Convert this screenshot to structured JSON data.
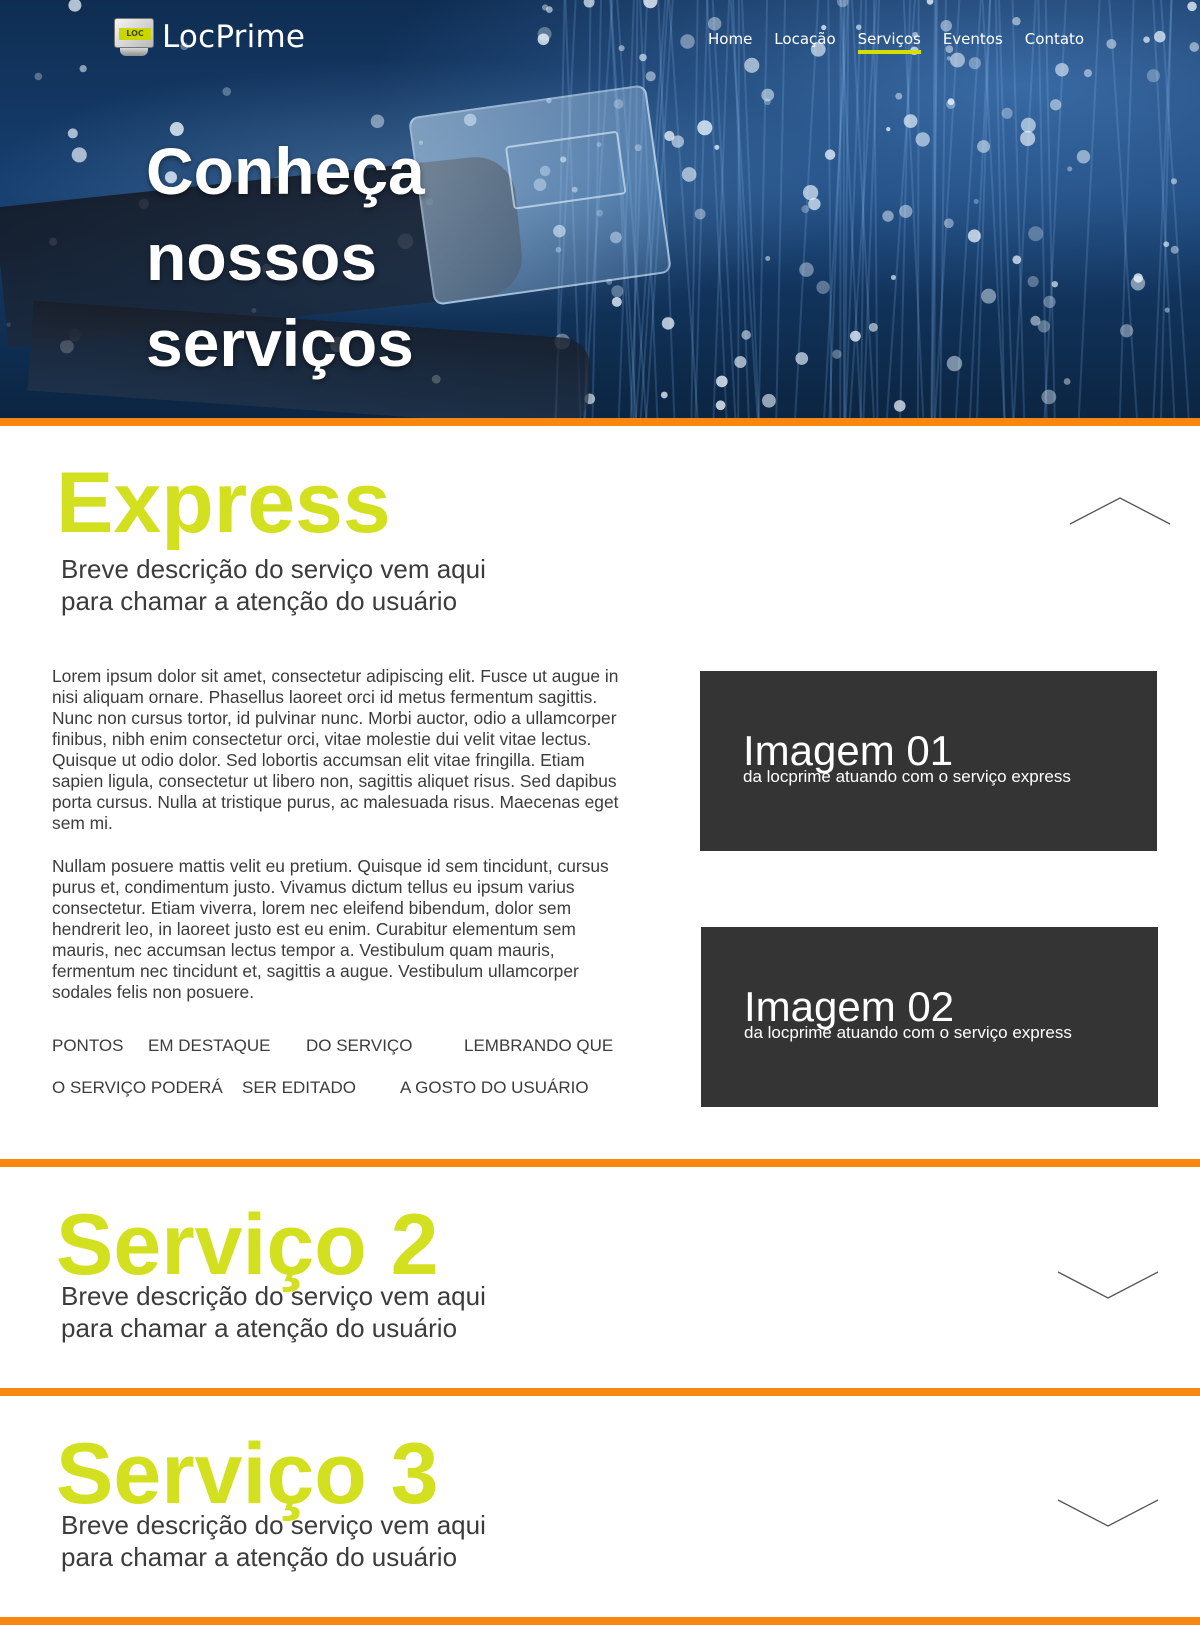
{
  "brand": {
    "name": "LocPrime",
    "logo_text": "LOC"
  },
  "nav": {
    "items": [
      {
        "label": "Home"
      },
      {
        "label": "Locação"
      },
      {
        "label": "Serviços"
      },
      {
        "label": "Eventos"
      },
      {
        "label": "Contato"
      }
    ],
    "active": "Serviços"
  },
  "hero": {
    "title_lines": [
      "Conheça",
      "nossos",
      "serviços"
    ]
  },
  "colors": {
    "accent_orange": "#f7870f",
    "accent_lime": "#d3e020",
    "dark_box": "#343434"
  },
  "express": {
    "title": "Express",
    "desc_line1": "Breve descrição do serviço vem aqui",
    "desc_line2": "para chamar a atenção do usuário",
    "paragraph1": " Lorem ipsum dolor sit amet, consectetur adipiscing elit. Fusce ut augue in nisi aliquam ornare. Phasellus laoreet orci id metus fermentum sagittis. Nunc non cursus tortor, id pulvinar nunc. Morbi auctor, odio a ullamcorper finibus, nibh enim consectetur orci, vitae molestie dui velit vitae lectus. Quisque ut odio dolor. Sed lobortis accumsan elit vitae fringilla. Etiam sapien ligula, consectetur ut libero non, sagittis aliquet risus. Sed dapibus porta cursus. Nulla at tristique purus, ac malesuada risus. Maecenas eget sem mi.",
    "paragraph2": "Nullam posuere mattis velit eu pretium. Quisque id sem tincidunt, cursus purus et, condimentum justo. Vivamus dictum tellus eu ipsum varius consectetur. Etiam viverra, lorem nec eleifend bibendum, dolor sem hendrerit leo, in laoreet justo est eu enim. Curabitur elementum sem mauris, nec accumsan lectus tempor a. Vestibulum quam mauris, fermentum nec tincidunt et, sagittis a augue. Vestibulum ullamcorper sodales felis non posuere.",
    "points_row1": [
      "PONTOS",
      "EM DESTAQUE",
      "DO SERVIÇO",
      "LEMBRANDO QUE"
    ],
    "points_row2": [
      "O SERVIÇO PODERÁ",
      "SER EDITADO",
      "A GOSTO DO USUÁRIO"
    ],
    "images": [
      {
        "title": "Imagem 01",
        "caption": "da locprime atuando com o serviço express"
      },
      {
        "title": "Imagem 02",
        "caption": "da locprime atuando com o serviço express"
      }
    ]
  },
  "servico2": {
    "title": "Serviço 2",
    "desc_line1": "Breve descrição do serviço vem aqui",
    "desc_line2": "para chamar a atenção do usuário"
  },
  "servico3": {
    "title": "Serviço 3",
    "desc_line1": "Breve descrição do serviço vem aqui",
    "desc_line2": "para chamar a atenção do usuário"
  }
}
